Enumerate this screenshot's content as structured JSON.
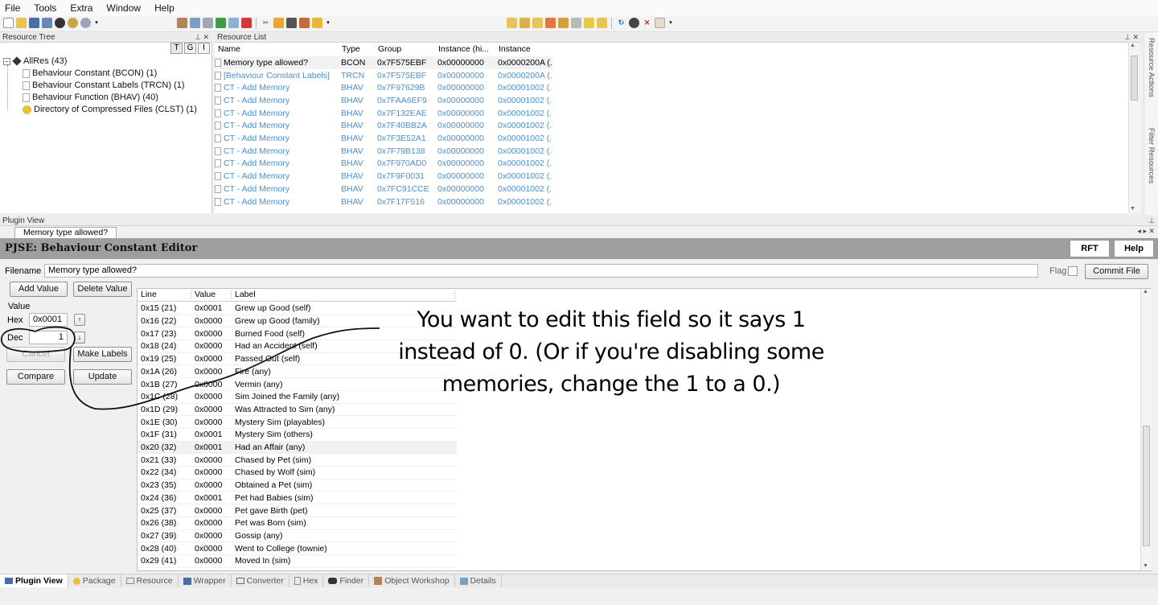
{
  "menu": [
    "File",
    "Tools",
    "Extra",
    "Window",
    "Help"
  ],
  "resource_tree": {
    "title": "Resource Tree",
    "buttons": [
      "T",
      "G",
      "I"
    ],
    "root": "AllRes (43)",
    "children": [
      "Behaviour Constant (BCON) (1)",
      "Behaviour Constant Labels (TRCN) (1)",
      "Behaviour Function (BHAV) (40)",
      "Directory of Compressed Files (CLST) (1)"
    ]
  },
  "resource_list": {
    "title": "Resource List",
    "columns": [
      "Name",
      "Type",
      "Group",
      "Instance (hi...",
      "Instance"
    ],
    "rows": [
      {
        "name": "Memory type allowed?",
        "type": "BCON",
        "group": "0x7F575EBF",
        "ihi": "0x00000000",
        "inst": "0x0000200A (...",
        "style": "normal"
      },
      {
        "name": "[Behaviour Constant Labels]",
        "type": "TRCN",
        "group": "0x7F575EBF",
        "ihi": "0x00000000",
        "inst": "0x0000200A (...",
        "style": "blue"
      },
      {
        "name": "CT - Add Memory",
        "type": "BHAV",
        "group": "0x7F97629B",
        "ihi": "0x00000000",
        "inst": "0x00001002 (...",
        "style": "blue"
      },
      {
        "name": "CT - Add Memory",
        "type": "BHAV",
        "group": "0x7FAA6EF9",
        "ihi": "0x00000000",
        "inst": "0x00001002 (...",
        "style": "blue"
      },
      {
        "name": "CT - Add Memory",
        "type": "BHAV",
        "group": "0x7F132EAE",
        "ihi": "0x00000000",
        "inst": "0x00001002 (...",
        "style": "blue"
      },
      {
        "name": "CT - Add Memory",
        "type": "BHAV",
        "group": "0x7F40BB2A",
        "ihi": "0x00000000",
        "inst": "0x00001002 (...",
        "style": "blue"
      },
      {
        "name": "CT - Add Memory",
        "type": "BHAV",
        "group": "0x7F3E52A1",
        "ihi": "0x00000000",
        "inst": "0x00001002 (...",
        "style": "blue"
      },
      {
        "name": "CT - Add Memory",
        "type": "BHAV",
        "group": "0x7F79B138",
        "ihi": "0x00000000",
        "inst": "0x00001002 (...",
        "style": "blue"
      },
      {
        "name": "CT - Add Memory",
        "type": "BHAV",
        "group": "0x7F970AD0",
        "ihi": "0x00000000",
        "inst": "0x00001002 (...",
        "style": "blue"
      },
      {
        "name": "CT - Add Memory",
        "type": "BHAV",
        "group": "0x7F9F0031",
        "ihi": "0x00000000",
        "inst": "0x00001002 (...",
        "style": "blue"
      },
      {
        "name": "CT - Add Memory",
        "type": "BHAV",
        "group": "0x7FC91CCE",
        "ihi": "0x00000000",
        "inst": "0x00001002 (...",
        "style": "blue"
      },
      {
        "name": "CT - Add Memory",
        "type": "BHAV",
        "group": "0x7F17F516",
        "ihi": "0x00000000",
        "inst": "0x00001002 (...",
        "style": "blue"
      }
    ]
  },
  "side_tabs": [
    "Resource Actions",
    "Filter Resources"
  ],
  "plugin_view": {
    "title": "Plugin View",
    "tab": "Memory type allowed?",
    "editor_title": "PJSE: Behaviour Constant Editor",
    "rft_label": "RFT",
    "help_label": "Help",
    "filename_label": "Filename",
    "filename_value": "Memory type allowed?",
    "flag_label": "Flag",
    "commit_label": "Commit File",
    "add_value": "Add Value",
    "delete_value": "Delete Value",
    "value_label": "Value",
    "hex_label": "Hex",
    "hex_value": "0x0001",
    "dec_label": "Dec",
    "dec_value": "1",
    "cancel_label": "Cancel",
    "make_labels": "Make Labels",
    "compare_label": "Compare",
    "update_label": "Update",
    "table_columns": [
      "Line",
      "Value",
      "Label"
    ],
    "table_rows": [
      {
        "line": "0x15 (21)",
        "value": "0x0001",
        "label": "Grew up Good (self)"
      },
      {
        "line": "0x16 (22)",
        "value": "0x0000",
        "label": "Grew up Good (family)"
      },
      {
        "line": "0x17 (23)",
        "value": "0x0000",
        "label": "Burned Food (self)"
      },
      {
        "line": "0x18 (24)",
        "value": "0x0000",
        "label": "Had an Accident (self)"
      },
      {
        "line": "0x19 (25)",
        "value": "0x0000",
        "label": "Passed Out (self)"
      },
      {
        "line": "0x1A (26)",
        "value": "0x0000",
        "label": "Fire (any)"
      },
      {
        "line": "0x1B (27)",
        "value": "0x0000",
        "label": "Vermin (any)"
      },
      {
        "line": "0x1C (28)",
        "value": "0x0000",
        "label": "Sim Joined the Family (any)"
      },
      {
        "line": "0x1D (29)",
        "value": "0x0000",
        "label": "Was Attracted to Sim (any)"
      },
      {
        "line": "0x1E (30)",
        "value": "0x0000",
        "label": "Mystery Sim (playables)"
      },
      {
        "line": "0x1F (31)",
        "value": "0x0001",
        "label": "Mystery Sim (others)"
      },
      {
        "line": "0x20 (32)",
        "value": "0x0001",
        "label": "Had an Affair (any)"
      },
      {
        "line": "0x21 (33)",
        "value": "0x0000",
        "label": "Chased by Pet (sim)"
      },
      {
        "line": "0x22 (34)",
        "value": "0x0000",
        "label": "Chased by Wolf (sim)"
      },
      {
        "line": "0x23 (35)",
        "value": "0x0000",
        "label": "Obtained a Pet (sim)"
      },
      {
        "line": "0x24 (36)",
        "value": "0x0001",
        "label": "Pet had Babies (sim)"
      },
      {
        "line": "0x25 (37)",
        "value": "0x0000",
        "label": "Pet gave Birth (pet)"
      },
      {
        "line": "0x26 (38)",
        "value": "0x0000",
        "label": "Pet was Born (sim)"
      },
      {
        "line": "0x27 (39)",
        "value": "0x0000",
        "label": "Gossip (any)"
      },
      {
        "line": "0x28 (40)",
        "value": "0x0000",
        "label": "Went to College (townie)"
      },
      {
        "line": "0x29 (41)",
        "value": "0x0000",
        "label": "Moved In (sim)"
      }
    ],
    "selected_row": 11
  },
  "annotation": "You want to edit this field so it says 1 instead of 0. (Or if you're disabling some memories, change the 1 to a 0.)",
  "bottom_tabs": [
    "Plugin View",
    "Package",
    "Resource",
    "Wrapper",
    "Converter",
    "Hex",
    "Finder",
    "Object Workshop",
    "Details"
  ],
  "colors": {
    "accent_blue": "#4a90d0",
    "title_bar": "#9e9e9e"
  }
}
